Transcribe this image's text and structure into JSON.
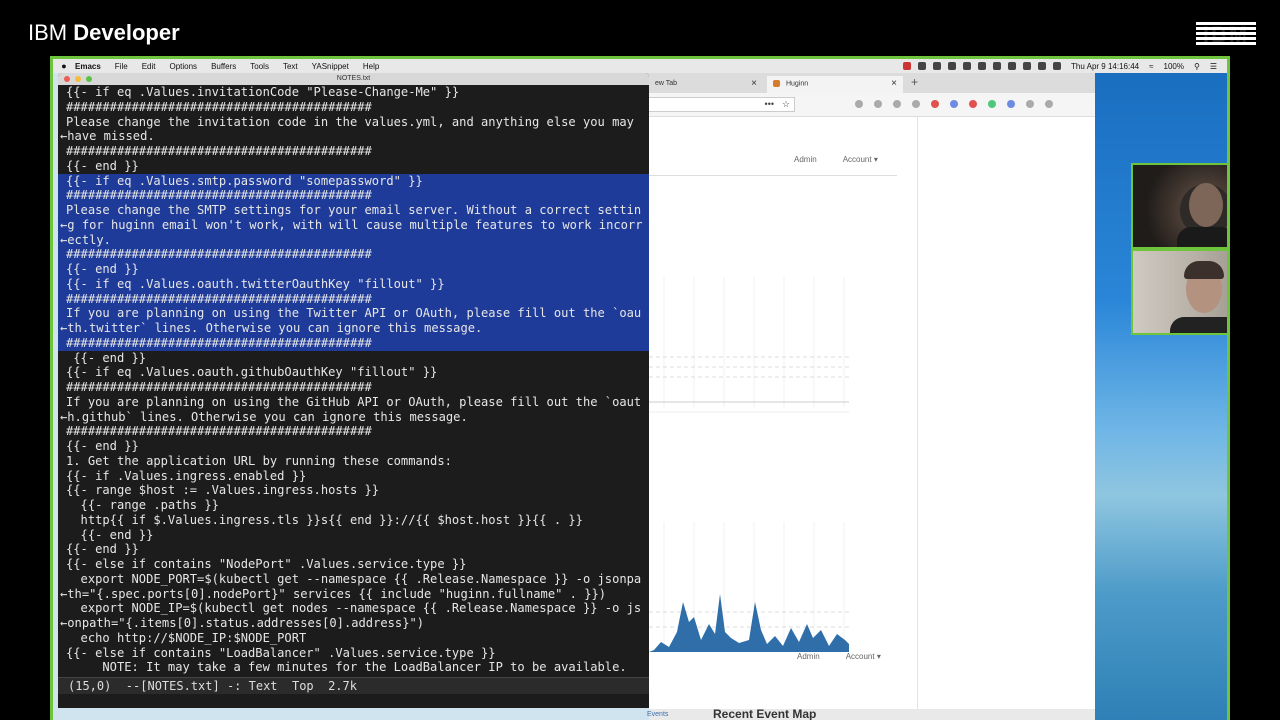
{
  "brand": {
    "name_light": "IBM",
    "name_bold": "Developer",
    "logo": "IBM"
  },
  "menubar": {
    "apple_icon": "",
    "app": "Emacs",
    "items": [
      "File",
      "Edit",
      "Options",
      "Buffers",
      "Tools",
      "Text",
      "YASnippet",
      "Help"
    ],
    "datetime": "Thu Apr 9  14:16:44",
    "battery": "100%"
  },
  "emacs": {
    "title": "NOTES.txt",
    "lines": [
      {
        "t": "{{- if eq .Values.invitationCode \"Please-Change-Me\" }}",
        "sel": false,
        "cont": false
      },
      {
        "t": "##########################################",
        "sel": false,
        "cont": false
      },
      {
        "t": "Please change the invitation code in the values.yml, and anything else you may",
        "sel": false,
        "cont": false
      },
      {
        "t": "←have missed.",
        "sel": false,
        "cont": true
      },
      {
        "t": "##########################################",
        "sel": false,
        "cont": false
      },
      {
        "t": "{{- end }}",
        "sel": false,
        "cont": false
      },
      {
        "t": "{{- if eq .Values.smtp.password \"somepassword\" }}",
        "sel": true,
        "cont": false
      },
      {
        "t": "##########################################",
        "sel": true,
        "cont": false
      },
      {
        "t": "Please change the SMTP settings for your email server. Without a correct settin",
        "sel": true,
        "cont": false
      },
      {
        "t": "←g for huginn email won't work, with will cause multiple features to work incorr",
        "sel": true,
        "cont": true
      },
      {
        "t": "←ectly.",
        "sel": true,
        "cont": true
      },
      {
        "t": "##########################################",
        "sel": true,
        "cont": false
      },
      {
        "t": "{{- end }}",
        "sel": true,
        "cont": false
      },
      {
        "t": "{{- if eq .Values.oauth.twitterOauthKey \"fillout\" }}",
        "sel": true,
        "cont": false
      },
      {
        "t": "##########################################",
        "sel": true,
        "cont": false
      },
      {
        "t": "If you are planning on using the Twitter API or OAuth, please fill out the `oau",
        "sel": true,
        "cont": false
      },
      {
        "t": "←th.twitter` lines. Otherwise you can ignore this message.",
        "sel": true,
        "cont": true
      },
      {
        "t": "##########################################",
        "sel": true,
        "cont": false
      },
      {
        "t": " {{- end }}",
        "sel": false,
        "cont": false
      },
      {
        "t": "{{- if eq .Values.oauth.githubOauthKey \"fillout\" }}",
        "sel": false,
        "cont": false
      },
      {
        "t": "##########################################",
        "sel": false,
        "cont": false
      },
      {
        "t": "If you are planning on using the GitHub API or OAuth, please fill out the `oaut",
        "sel": false,
        "cont": false
      },
      {
        "t": "←h.github` lines. Otherwise you can ignore this message.",
        "sel": false,
        "cont": true
      },
      {
        "t": "##########################################",
        "sel": false,
        "cont": false
      },
      {
        "t": "{{- end }}",
        "sel": false,
        "cont": false
      },
      {
        "t": "1. Get the application URL by running these commands:",
        "sel": false,
        "cont": false
      },
      {
        "t": "{{- if .Values.ingress.enabled }}",
        "sel": false,
        "cont": false
      },
      {
        "t": "{{- range $host := .Values.ingress.hosts }}",
        "sel": false,
        "cont": false
      },
      {
        "t": "  {{- range .paths }}",
        "sel": false,
        "cont": false
      },
      {
        "t": "  http{{ if $.Values.ingress.tls }}s{{ end }}://{{ $host.host }}{{ . }}",
        "sel": false,
        "cont": false
      },
      {
        "t": "  {{- end }}",
        "sel": false,
        "cont": false
      },
      {
        "t": "{{- end }}",
        "sel": false,
        "cont": false
      },
      {
        "t": "{{- else if contains \"NodePort\" .Values.service.type }}",
        "sel": false,
        "cont": false
      },
      {
        "t": "  export NODE_PORT=$(kubectl get --namespace {{ .Release.Namespace }} -o jsonpa",
        "sel": false,
        "cont": false
      },
      {
        "t": "←th=\"{.spec.ports[0].nodePort}\" services {{ include \"huginn.fullname\" . }})",
        "sel": false,
        "cont": true
      },
      {
        "t": "  export NODE_IP=$(kubectl get nodes --namespace {{ .Release.Namespace }} -o js",
        "sel": false,
        "cont": false
      },
      {
        "t": "←onpath=\"{.items[0].status.addresses[0].address}\")",
        "sel": false,
        "cont": true
      },
      {
        "t": "  echo http://$NODE_IP:$NODE_PORT",
        "sel": false,
        "cont": false
      },
      {
        "t": "{{- else if contains \"LoadBalancer\" .Values.service.type }}",
        "sel": false,
        "cont": false
      },
      {
        "t": "     NOTE: It may take a few minutes for the LoadBalancer IP to be available.",
        "sel": false,
        "cont": false
      }
    ],
    "modeline": "(15,0)  --[NOTES.txt] -: Text  Top  2.7k"
  },
  "browser": {
    "tabs": [
      {
        "label": "ew Tab",
        "close": "×"
      },
      {
        "label": "Huginn",
        "close": "×"
      }
    ],
    "new_tab": "+",
    "url_menu": "•••",
    "bookmark": "☆",
    "nav_top": {
      "admin": "Admin",
      "account": "Account ▾"
    },
    "nav_bottom": {
      "admin": "Admin",
      "account": "Account ▾"
    },
    "footer_title": "Recent Event Map",
    "footer_link": "Events"
  },
  "colors": {
    "selection": "#1f3b9a",
    "frame": "#6ec43b",
    "chart_fill": "#2f6ea8"
  }
}
